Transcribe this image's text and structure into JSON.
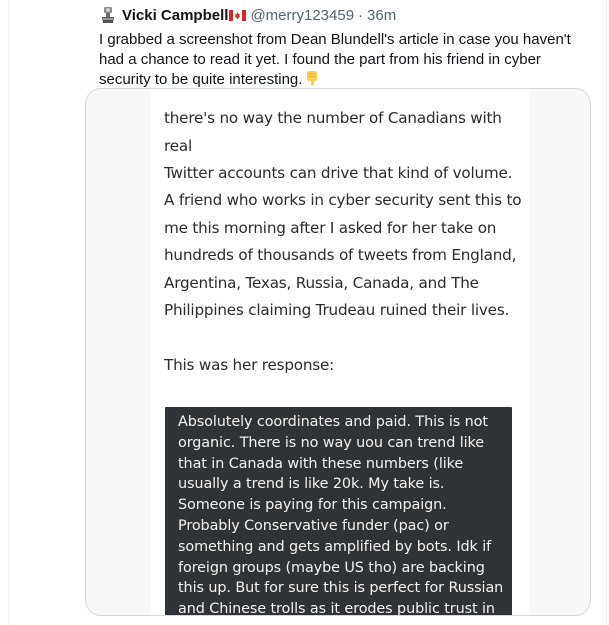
{
  "tweet": {
    "author_name": "Vicki Campbell",
    "handle": "@merry123459",
    "separator": "·",
    "time": "36m",
    "text": "I grabbed a screenshot from Dean Blundell's article in case you haven't had a chance to read it yet. I found the part from his friend in cyber security to be quite interesting."
  },
  "media": {
    "paragraph_1": "there's no way the number of Canadians with real\nTwitter accounts can drive that kind of volume.",
    "paragraph_2": "A friend who works in cyber security sent this to\nme this morning after I asked for her take on\nhundreds of thousands of tweets from England,\nArgentina, Texas, Russia, Canada, and The\nPhilippines claiming Trudeau ruined their lives.",
    "paragraph_3": "This was her response:",
    "quote": "Absolutely coordinates and paid. This is not\norganic. There is no way uou can trend like\nthat in Canada with these numbers (like\nusually a trend is like 20k. My take is.\nSomeone is paying for this campaign.\nProbably Conservative funder (pac) or\nsomething and gets amplified by bots. Idk if\nforeign groups (maybe US tho) are backing\nthis up. But for sure this is perfect for Russian\nand Chinese trolls as it erodes public trust in"
  },
  "icons": {
    "avatar": "old-telephone-icon",
    "flag": "canada-flag-icon",
    "emoji": "backhand-index-pointing-down-icon"
  },
  "colors": {
    "secondary_text": "#536471",
    "card_border": "#cfd9de",
    "quote_background": "#2f3336",
    "flag_red": "#d52b1e",
    "emoji_yellow": "#ffcc4d"
  }
}
